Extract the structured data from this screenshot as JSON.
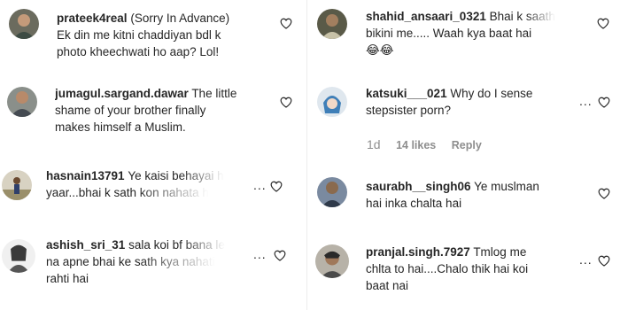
{
  "left": {
    "comments": [
      {
        "username": "prateek4real",
        "lines": [
          "(Sorry In Advance)",
          "Ek din me kitni chaddiyan bdl k",
          "photo kheechwati ho aap? Lol!"
        ]
      },
      {
        "username": "jumagul.sargand.dawar",
        "lines": [
          "The little",
          "shame of your brother finally",
          "makes himself a Muslim."
        ]
      },
      {
        "username": "hasnain13791",
        "lines": [
          "Ye kaisi behayai h",
          "yaar...bhai k sath kon nahata h"
        ]
      },
      {
        "username": "ashish_sri_31",
        "lines": [
          "sala koi bf bana le",
          "na apne bhai ke sath kya nahati",
          "rahti hai"
        ]
      }
    ]
  },
  "right": {
    "comments": [
      {
        "username": "shahid_ansaari_0321",
        "lines": [
          "Bhai k saath",
          "bikini me..... Waah kya baat hai",
          "😂😂"
        ]
      },
      {
        "username": "katsuki___021",
        "lines": [
          "Why do I sense",
          "stepsister porn?"
        ],
        "meta": {
          "age": "1d",
          "likes": "14 likes",
          "reply": "Reply"
        }
      },
      {
        "username": "saurabh__singh06",
        "lines": [
          "Ye muslman",
          "hai inka chalta hai"
        ]
      },
      {
        "username": "pranjal.singh.7927",
        "lines": [
          "Tmlog me",
          "chlta to hai....Chalo thik hai koi",
          "baat nai"
        ]
      }
    ]
  },
  "icons": {
    "like": "heart-outline-icon",
    "options": "more-options-icon"
  },
  "options_glyph": "...",
  "colors": {
    "text": "#262626",
    "meta": "#8e8e8e",
    "heart": "#262626",
    "background": "#ffffff"
  }
}
